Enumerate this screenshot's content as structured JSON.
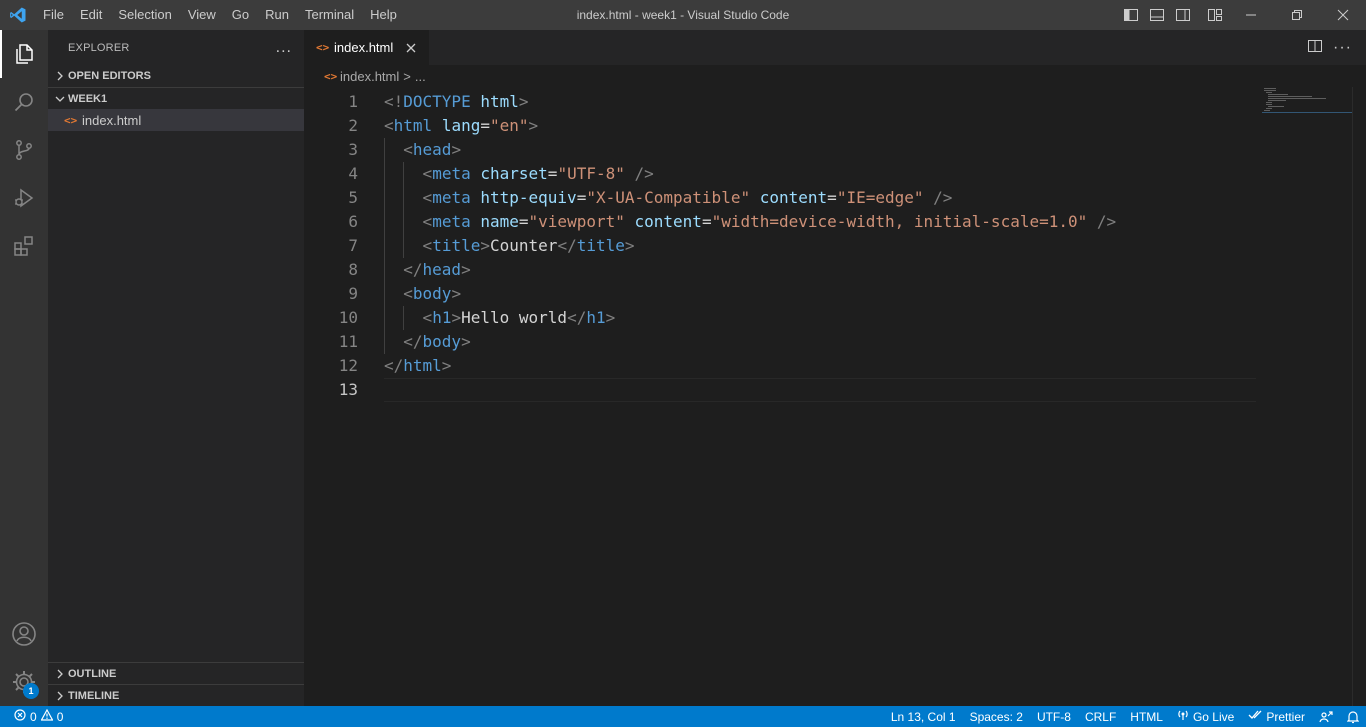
{
  "window": {
    "title": "index.html - week1 - Visual Studio Code"
  },
  "menu": [
    "File",
    "Edit",
    "Selection",
    "View",
    "Go",
    "Run",
    "Terminal",
    "Help"
  ],
  "sidebar": {
    "title": "EXPLORER",
    "more": "...",
    "sections": {
      "open_editors": "OPEN EDITORS",
      "folder": "WEEK1",
      "outline": "OUTLINE",
      "timeline": "TIMELINE"
    },
    "files": [
      {
        "icon": "<>",
        "name": "index.html"
      }
    ]
  },
  "editor": {
    "tab": {
      "icon": "<>",
      "label": "index.html"
    },
    "breadcrumb": {
      "icon": "<>",
      "file": "index.html",
      "sep": ">",
      "more": "..."
    },
    "current_line": 13,
    "lines": [
      {
        "n": "1",
        "text": "<!DOCTYPE html>"
      },
      {
        "n": "2",
        "text": "<html lang=\"en\">"
      },
      {
        "n": "3",
        "text": "<head>"
      },
      {
        "n": "4",
        "text": "<meta charset=\"UTF-8\" />"
      },
      {
        "n": "5",
        "text": "<meta http-equiv=\"X-UA-Compatible\" content=\"IE=edge\" />"
      },
      {
        "n": "6",
        "text": "<meta name=\"viewport\" content=\"width=device-width, initial-scale=1.0\" />"
      },
      {
        "n": "7",
        "text": "<title>Counter</title>"
      },
      {
        "n": "8",
        "text": "</head>"
      },
      {
        "n": "9",
        "text": "<body>"
      },
      {
        "n": "10",
        "text": "<h1>Hello world</h1>"
      },
      {
        "n": "11",
        "text": "</body>"
      },
      {
        "n": "12",
        "text": "</html>"
      },
      {
        "n": "13",
        "text": ""
      }
    ]
  },
  "status": {
    "errors": "0",
    "warnings": "0",
    "position": "Ln 13, Col 1",
    "spaces": "Spaces: 2",
    "encoding": "UTF-8",
    "eol": "CRLF",
    "language": "HTML",
    "go_live": "Go Live",
    "prettier": "Prettier"
  },
  "badges": {
    "settings": "1"
  },
  "colors": {
    "accent": "#007acc",
    "tag": "#569cd6",
    "attribute": "#9cdcfe",
    "string": "#ce9178",
    "html_icon": "#e37933"
  }
}
